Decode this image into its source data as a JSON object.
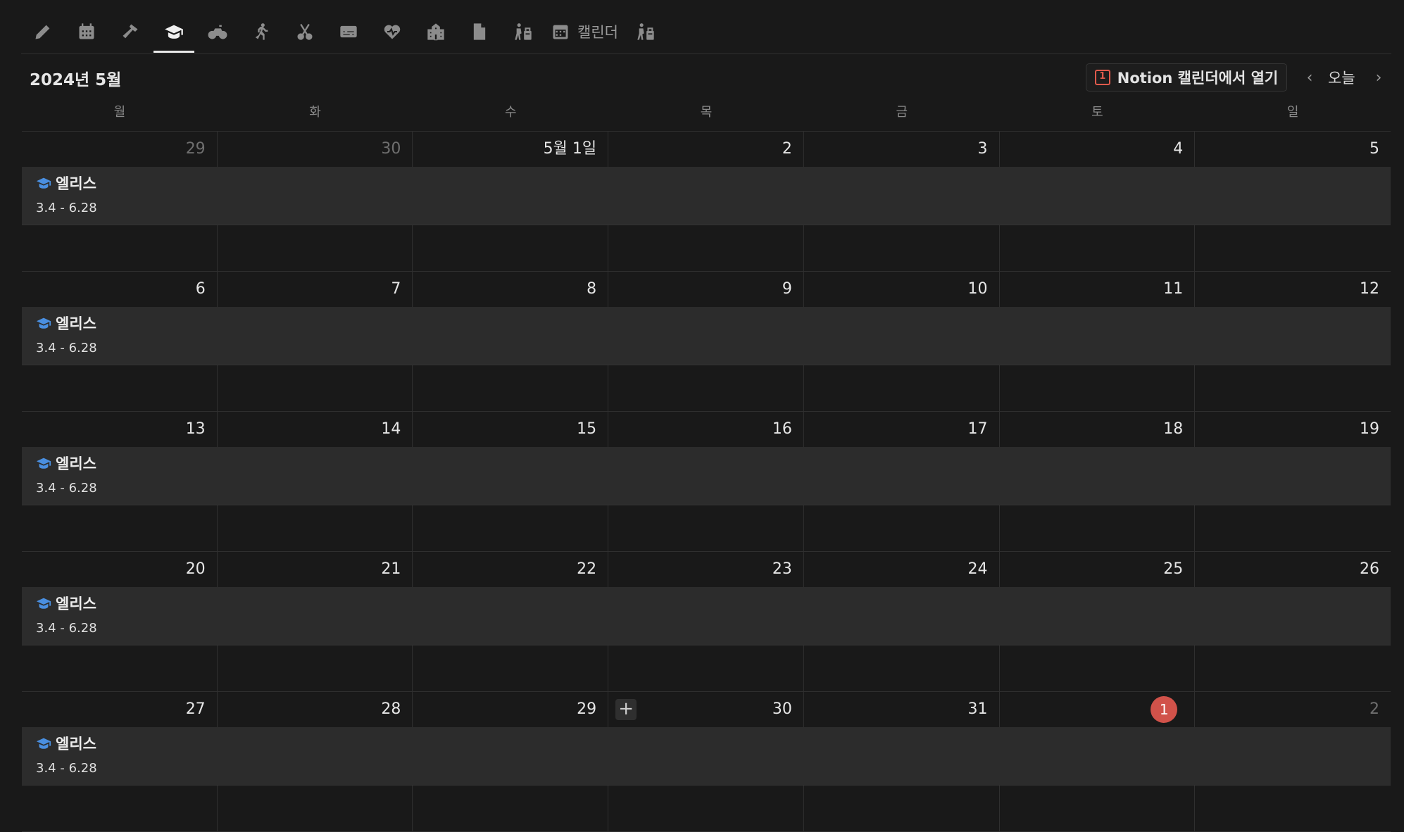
{
  "tabs": [
    {
      "icon": "pencil-icon",
      "label": ""
    },
    {
      "icon": "calendar-grid-icon",
      "label": ""
    },
    {
      "icon": "hammer-icon",
      "label": ""
    },
    {
      "icon": "graduation-cap-icon",
      "label": "",
      "active": true
    },
    {
      "icon": "bicycle-icon",
      "label": ""
    },
    {
      "icon": "running-person-icon",
      "label": ""
    },
    {
      "icon": "scissors-icon",
      "label": ""
    },
    {
      "icon": "subtitles-icon",
      "label": ""
    },
    {
      "icon": "heart-pulse-icon",
      "label": ""
    },
    {
      "icon": "school-building-icon",
      "label": ""
    },
    {
      "icon": "document-icon",
      "label": ""
    },
    {
      "icon": "person-with-bag-icon",
      "label": ""
    },
    {
      "icon": "calendar-icon",
      "label": "캘린더"
    },
    {
      "icon": "person-with-bag-icon",
      "label": ""
    }
  ],
  "header": {
    "title": "2024년 5월",
    "open_button": "Notion 캘린더에서 열기",
    "open_button_icon_text": "1",
    "today": "오늘"
  },
  "weekdays": [
    "월",
    "화",
    "수",
    "목",
    "금",
    "토",
    "일"
  ],
  "weeks": [
    {
      "days": [
        {
          "label": "29",
          "other": true
        },
        {
          "label": "30",
          "other": true
        },
        {
          "label": "5월 1일"
        },
        {
          "label": "2"
        },
        {
          "label": "3"
        },
        {
          "label": "4"
        },
        {
          "label": "5"
        }
      ]
    },
    {
      "days": [
        {
          "label": "6"
        },
        {
          "label": "7"
        },
        {
          "label": "8"
        },
        {
          "label": "9"
        },
        {
          "label": "10"
        },
        {
          "label": "11"
        },
        {
          "label": "12"
        }
      ]
    },
    {
      "days": [
        {
          "label": "13"
        },
        {
          "label": "14"
        },
        {
          "label": "15"
        },
        {
          "label": "16"
        },
        {
          "label": "17"
        },
        {
          "label": "18"
        },
        {
          "label": "19"
        }
      ]
    },
    {
      "days": [
        {
          "label": "20"
        },
        {
          "label": "21"
        },
        {
          "label": "22"
        },
        {
          "label": "23"
        },
        {
          "label": "24"
        },
        {
          "label": "25"
        },
        {
          "label": "26"
        }
      ]
    },
    {
      "days": [
        {
          "label": "27"
        },
        {
          "label": "28"
        },
        {
          "label": "29"
        },
        {
          "label": "30",
          "add": true
        },
        {
          "label": "31"
        },
        {
          "label": "1",
          "today": true
        },
        {
          "label": "2",
          "other": true
        }
      ]
    }
  ],
  "event": {
    "icon": "graduation-cap-icon",
    "title": "엘리스",
    "dates": "3.4 - 6.28",
    "color": "#4a8fe0"
  },
  "colors": {
    "background": "#191919",
    "event_bar": "#2c2c2c",
    "today_badge": "#d1524a",
    "accent_blue": "#4a8fe0"
  }
}
